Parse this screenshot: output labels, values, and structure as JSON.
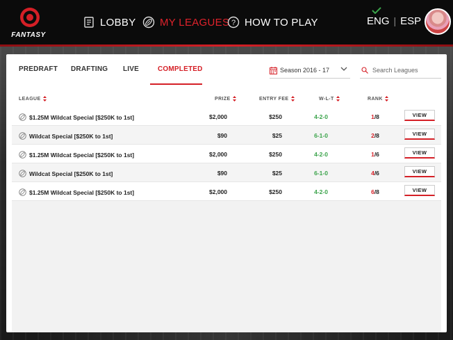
{
  "header": {
    "brand": "FANTASY",
    "nav": [
      {
        "label": "LOBBY",
        "active": false
      },
      {
        "label": "MY LEAGUES",
        "active": true
      },
      {
        "label": "HOW TO PLAY",
        "active": false
      }
    ],
    "languages": [
      "ENG",
      "ESP"
    ],
    "language_separator": "|",
    "selected_language": "ENG"
  },
  "tabs": [
    {
      "label": "PREDRAFT",
      "active": false
    },
    {
      "label": "DRAFTING",
      "active": false
    },
    {
      "label": "LIVE",
      "active": false
    },
    {
      "label": "COMPLETED",
      "active": true
    }
  ],
  "season": {
    "value": "Season 2016 - 17"
  },
  "search": {
    "placeholder": "Search Leagues",
    "value": ""
  },
  "table": {
    "columns": [
      "LEAGUE",
      "PRIZE",
      "ENTRY FEE",
      "W-L-T",
      "RANK"
    ],
    "rows": [
      {
        "league": "$1.25M Wildcat Special [$250K to 1st]",
        "prize": "$2,000",
        "fee": "$250",
        "wlt": "4-2-0",
        "rank_pos": "1",
        "rank_total": "/8",
        "action": "VIEW"
      },
      {
        "league": "Wildcat Special [$250K to 1st]",
        "prize": "$90",
        "fee": "$25",
        "wlt": "6-1-0",
        "rank_pos": "2",
        "rank_total": "/8",
        "action": "VIEW"
      },
      {
        "league": "$1.25M Wildcat Special [$250K to 1st]",
        "prize": "$2,000",
        "fee": "$250",
        "wlt": "4-2-0",
        "rank_pos": "1",
        "rank_total": "/6",
        "action": "VIEW"
      },
      {
        "league": "Wildcat Special [$250K to 1st]",
        "prize": "$90",
        "fee": "$25",
        "wlt": "6-1-0",
        "rank_pos": "4",
        "rank_total": "/6",
        "action": "VIEW"
      },
      {
        "league": "$1.25M Wildcat Special [$250K to 1st]",
        "prize": "$2,000",
        "fee": "$250",
        "wlt": "4-2-0",
        "rank_pos": "6",
        "rank_total": "/8",
        "action": "VIEW"
      }
    ]
  },
  "colors": {
    "accent": "#d51f26",
    "win": "#3aa34a",
    "header_bg": "#0b0b0b"
  }
}
